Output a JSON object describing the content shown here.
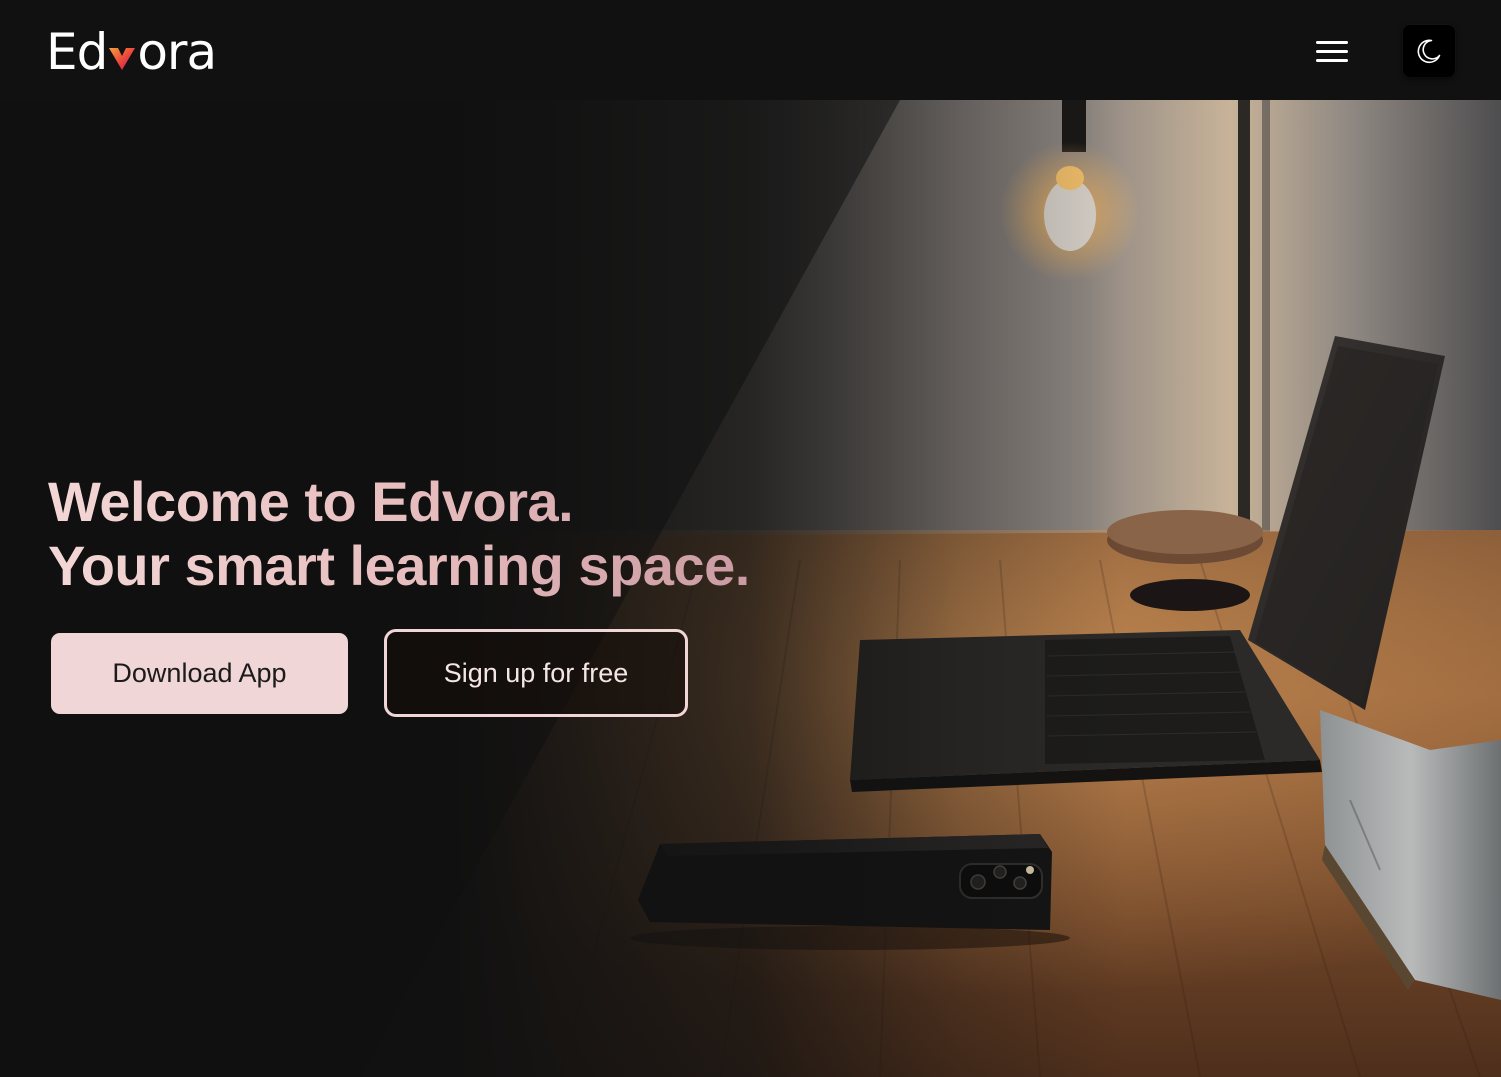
{
  "header": {
    "logo_text_before": "Ed",
    "logo_text_after": "ora",
    "menu_icon": "hamburger-menu-icon",
    "theme_icon": "moon-icon"
  },
  "hero": {
    "headline_line1": "Welcome to Edvora.",
    "headline_line2": "Your smart learning space.",
    "primary_button": "Download App",
    "secondary_button": "Sign up for free",
    "background_image": "desk-with-laptop-phone-and-lamp"
  },
  "colors": {
    "background": "#111111",
    "accent_pink": "#f1d6d7",
    "logo_v_orange": "#f2762e",
    "logo_v_magenta": "#d3175f"
  }
}
